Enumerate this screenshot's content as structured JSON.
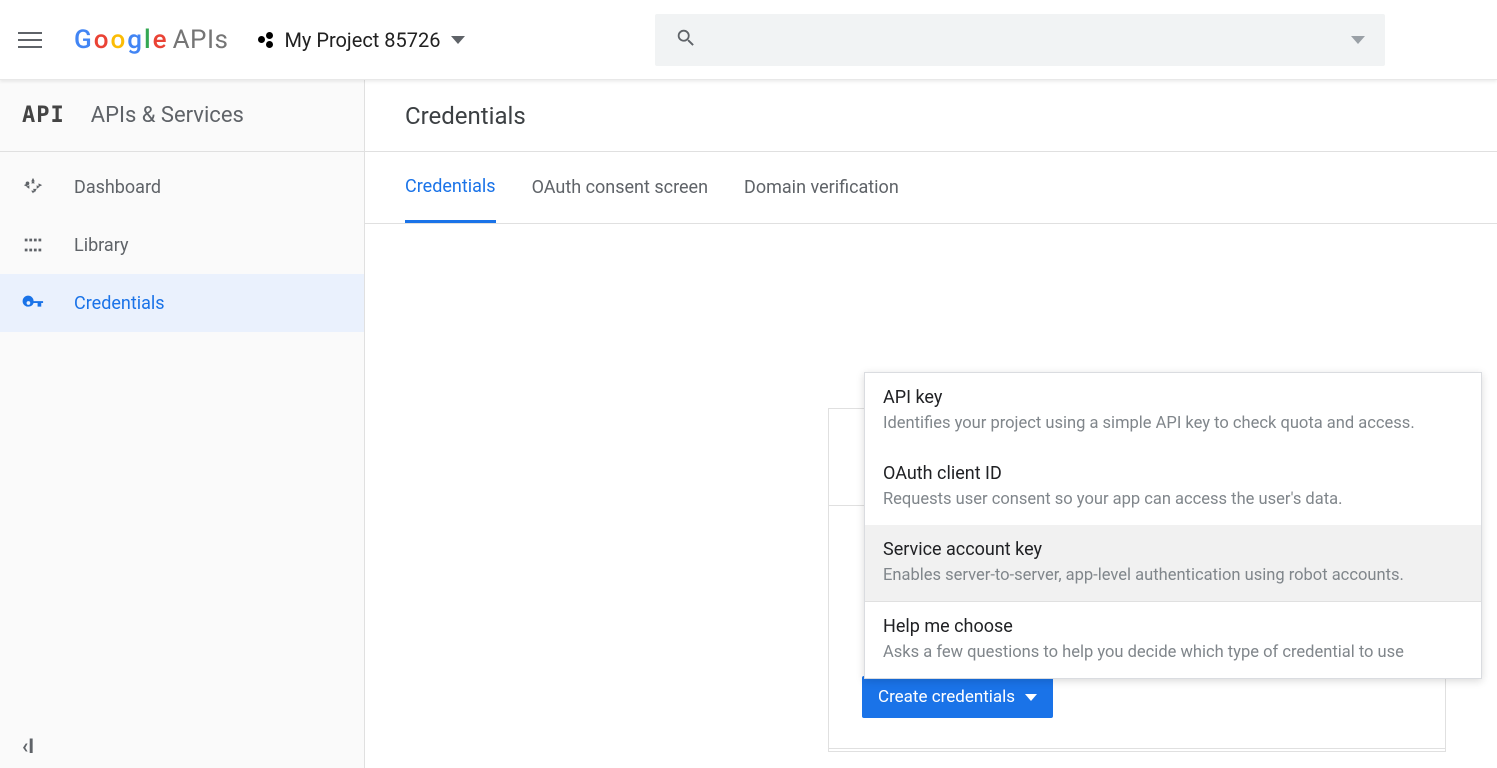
{
  "header": {
    "logo_suffix": "APIs",
    "project_name": "My Project 85726"
  },
  "sidebar": {
    "title": "APIs & Services",
    "items": [
      {
        "label": "Dashboard"
      },
      {
        "label": "Library"
      },
      {
        "label": "Credentials"
      }
    ]
  },
  "main": {
    "title": "Credentials",
    "tabs": [
      {
        "label": "Credentials"
      },
      {
        "label": "OAuth consent screen"
      },
      {
        "label": "Domain verification"
      }
    ],
    "create_button": "Create credentials",
    "dropdown": [
      {
        "title": "API key",
        "desc": "Identifies your project using a simple API key to check quota and access."
      },
      {
        "title": "OAuth client ID",
        "desc": "Requests user consent so your app can access the user's data."
      },
      {
        "title": "Service account key",
        "desc": "Enables server-to-server, app-level authentication using robot accounts."
      },
      {
        "title": "Help me choose",
        "desc": "Asks a few questions to help you decide which type of credential to use"
      }
    ]
  }
}
